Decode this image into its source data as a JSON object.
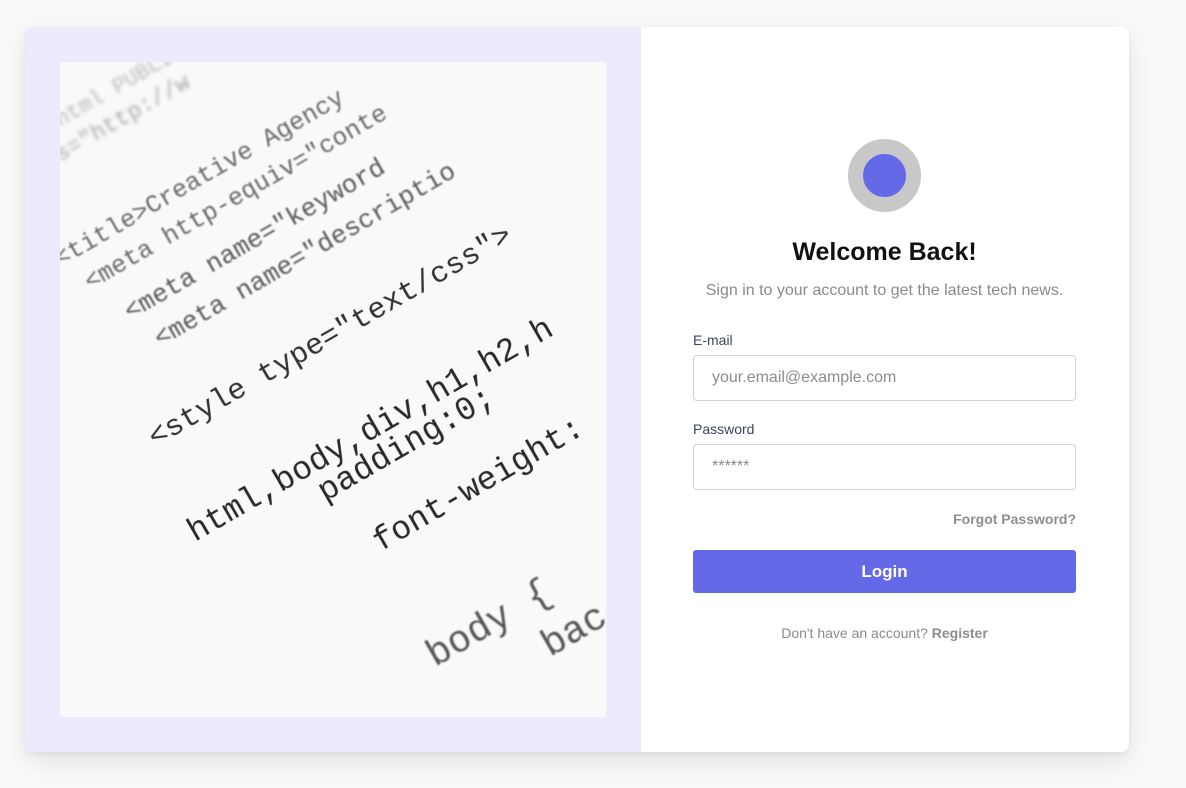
{
  "hero_image": {
    "code_lines": [
      "html PUBLIC",
      "s=\"http://w",
      "<title>Creative Agency",
      "<meta http-equiv=\"conte",
      "<meta name=\"keyword",
      "<meta name=\"descriptio",
      "<style type=\"text/css\">",
      "html,body,div,h1,h2,h",
      "padding:0;",
      "font-weight:",
      "body {",
      "bac"
    ]
  },
  "login": {
    "title": "Welcome Back!",
    "subtitle": "Sign in to your account to get the latest tech news.",
    "email": {
      "label": "E-mail",
      "placeholder": "your.email@example.com",
      "value": ""
    },
    "password": {
      "label": "Password",
      "placeholder": "******",
      "value": ""
    },
    "forgot_password": "Forgot Password?",
    "login_button": "Login",
    "register_prompt": "Don't have an account?",
    "register_link": "Register"
  },
  "colors": {
    "accent": "#6469e8",
    "left_panel_bg": "#ecebfd",
    "logo_ring": "#c8c8c8",
    "muted_text": "#8a8a8a"
  }
}
